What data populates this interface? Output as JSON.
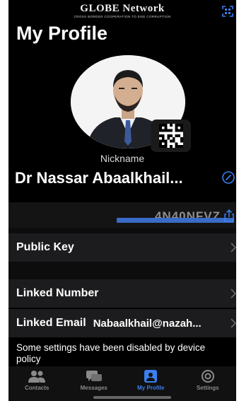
{
  "brand": {
    "title": "GLOBE Network",
    "subtitle": "CROSS BORDER COOPERATION TO END CORRUPTION"
  },
  "header": {
    "title": "My Profile"
  },
  "profile": {
    "nickname_caption": "Nickname",
    "nickname": "Dr Nassar Abaalkhail...",
    "public_key_fragment": "4N40NFVZ"
  },
  "rows": {
    "public_key_label": "Public Key",
    "linked_number_label": "Linked Number",
    "linked_email_label": "Linked Email",
    "linked_email_value": "Nabaalkhail@nazah..."
  },
  "notice": "Some settings have been disabled by device policy",
  "tabs": [
    {
      "label": "Contacts",
      "icon": "contacts-icon"
    },
    {
      "label": "Messages",
      "icon": "messages-icon"
    },
    {
      "label": "My Profile",
      "icon": "profile-icon",
      "active": true
    },
    {
      "label": "Settings",
      "icon": "settings-icon"
    }
  ],
  "colors": {
    "accent": "#3b7ff0",
    "background": "#000000",
    "row": "#1c1c1e"
  }
}
